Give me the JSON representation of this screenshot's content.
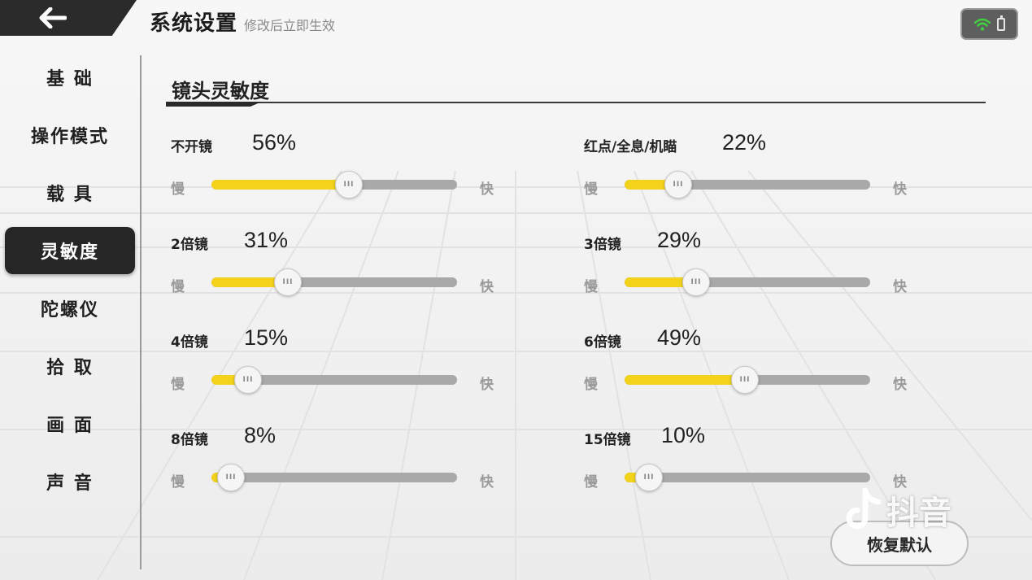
{
  "header": {
    "back_icon": "arrow-left-icon",
    "title": "系统设置",
    "subtitle": "修改后立即生效"
  },
  "status": {
    "wifi_icon": "wifi-icon",
    "battery_icon": "battery-icon",
    "wifi_color": "#3fd13f"
  },
  "sidebar": {
    "items": [
      {
        "label": "基 础"
      },
      {
        "label": "操作模式"
      },
      {
        "label": "载 具"
      },
      {
        "label": "灵敏度",
        "active": true
      },
      {
        "label": "陀螺仪"
      },
      {
        "label": "拾 取"
      },
      {
        "label": "画 面"
      },
      {
        "label": "声 音"
      }
    ]
  },
  "section": {
    "title": "镜头灵敏度"
  },
  "sliders": [
    {
      "label": "不开镜",
      "value": "56%",
      "percent": 56,
      "slow": "慢",
      "fast": "快",
      "thumb": "III"
    },
    {
      "label": "红点/全息/机瞄",
      "value": "22%",
      "percent": 22,
      "slow": "慢",
      "fast": "快",
      "thumb": "III"
    },
    {
      "label": "2倍镜",
      "value": "31%",
      "percent": 31,
      "slow": "慢",
      "fast": "快",
      "thumb": "III"
    },
    {
      "label": "3倍镜",
      "value": "29%",
      "percent": 29,
      "slow": "慢",
      "fast": "快",
      "thumb": "III"
    },
    {
      "label": "4倍镜",
      "value": "15%",
      "percent": 15,
      "slow": "慢",
      "fast": "快",
      "thumb": "III"
    },
    {
      "label": "6倍镜",
      "value": "49%",
      "percent": 49,
      "slow": "慢",
      "fast": "快",
      "thumb": "III"
    },
    {
      "label": "8倍镜",
      "value": "8%",
      "percent": 8,
      "slow": "慢",
      "fast": "快",
      "thumb": "III"
    },
    {
      "label": "15倍镜",
      "value": "10%",
      "percent": 10,
      "slow": "慢",
      "fast": "快",
      "thumb": "III"
    }
  ],
  "colors": {
    "accent": "#f2d21a",
    "track": "#a9a9a9",
    "dark": "#262626"
  },
  "reset_button": {
    "label": "恢复默认"
  },
  "watermark": {
    "text": "抖音",
    "icon": "douyin-logo-icon"
  }
}
